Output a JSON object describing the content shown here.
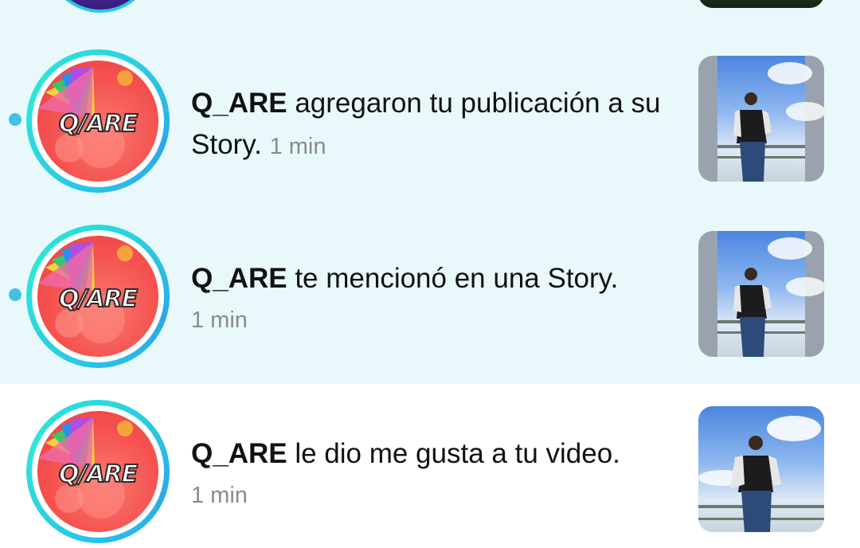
{
  "notifications": [
    {
      "username": "Q_ARE",
      "message": " agregaron tu publicación a su Story.",
      "time": "1 min",
      "unread": true,
      "avatar_logo": "Q/ARE"
    },
    {
      "username": "Q_ARE",
      "message": " te mencionó en una Story.",
      "time": "1 min",
      "unread": true,
      "avatar_logo": "Q/ARE"
    },
    {
      "username": "Q_ARE",
      "message": " le dio me gusta a tu video.",
      "time": "1 min",
      "unread": false,
      "avatar_logo": "Q/ARE"
    }
  ],
  "colors": {
    "unread_background": "#e9f9fb",
    "unread_dot": "#3ec3e6",
    "story_ring": "#28c8e9",
    "time_text": "#8a8a8a"
  },
  "icons": [
    "unread-dot-icon"
  ]
}
